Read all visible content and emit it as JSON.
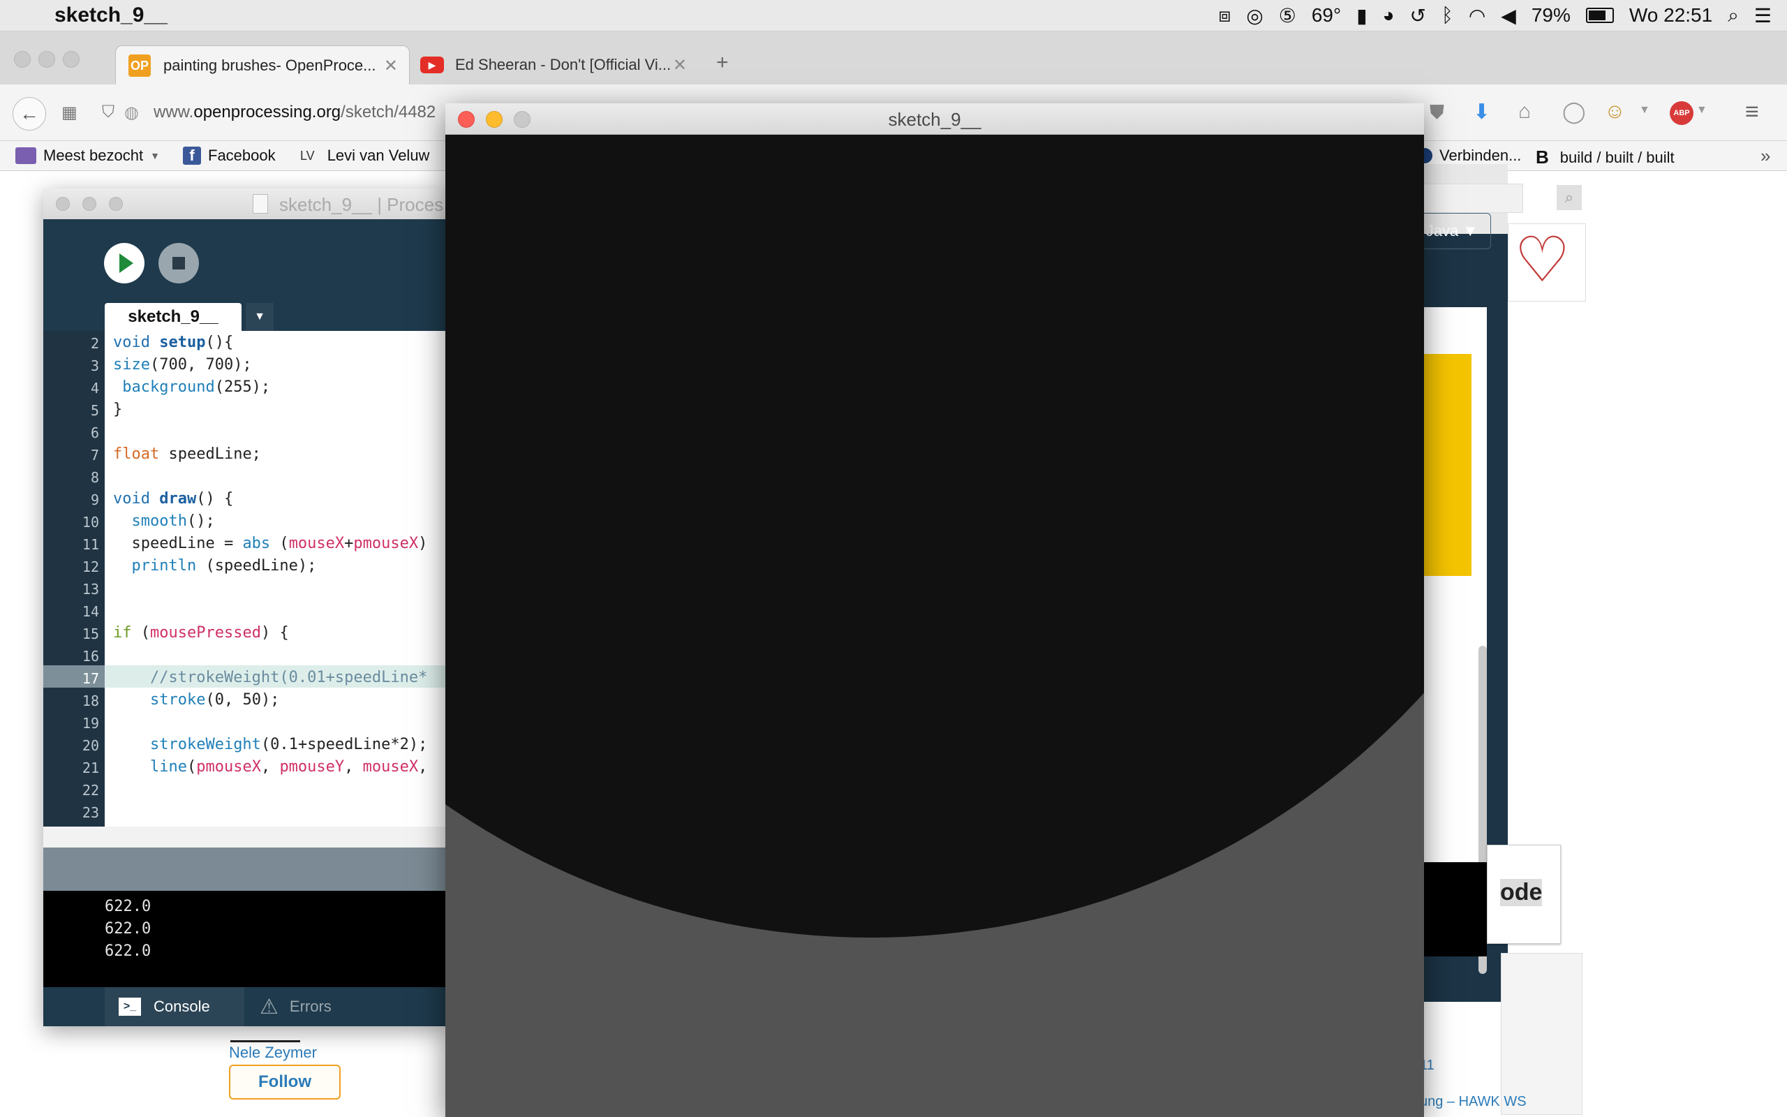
{
  "menubar": {
    "app_name": "sketch_9__",
    "temperature": "69°",
    "battery": "79%",
    "clock": "Wo 22:51"
  },
  "browser": {
    "tabs": [
      {
        "label": "painting brushes- OpenProce...",
        "favicon": "OP"
      },
      {
        "label": "Ed Sheeran - Don't [Official Vi...",
        "favicon": "youtube-icon"
      }
    ],
    "url_domain": "openprocessing.org",
    "url_prefix": "www.",
    "url_path": "/sketch/4482",
    "bookmarks": [
      {
        "label": "Meest bezocht"
      },
      {
        "label": "Facebook"
      },
      {
        "label": "Levi van Veluw",
        "prefix": "LV"
      },
      {
        "label": "Verbinden..."
      },
      {
        "label": "build / built / built",
        "prefix": "B"
      }
    ]
  },
  "webpage": {
    "author": "Nele Zeymer",
    "follow_label": "Follow",
    "mode_label": "Java ▼",
    "count_fragment": "11",
    "link_fragment": "ung – HAWK WS",
    "code_fragment": "ode"
  },
  "ide": {
    "title": "sketch_9__ | Proces",
    "tab_label": "sketch_9__",
    "tab_menu": "▼",
    "console_tab": "Console",
    "errors_tab": "Errors",
    "line_numbers": [
      "2",
      "3",
      "4",
      "5",
      "6",
      "7",
      "8",
      "9",
      "10",
      "11",
      "12",
      "13",
      "14",
      "15",
      "16",
      "17",
      "18",
      "19",
      "20",
      "21",
      "22",
      "23"
    ],
    "console_lines": [
      "622.0",
      "622.0",
      "622.0"
    ]
  },
  "sketch": {
    "title": "sketch_9__",
    "canvas_bg": "#535353",
    "circle_fill": "#111111"
  }
}
